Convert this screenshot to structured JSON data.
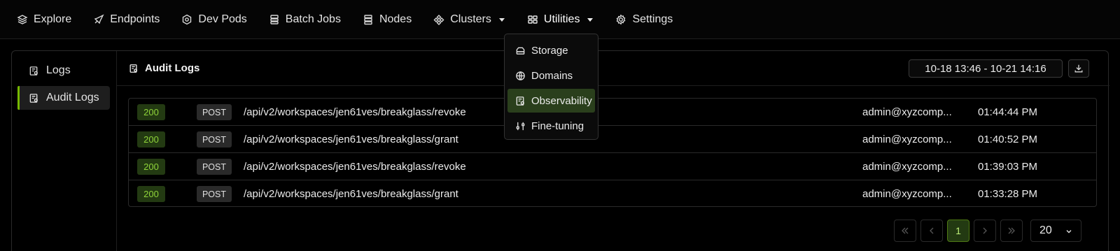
{
  "nav": {
    "items": [
      {
        "label": "Explore",
        "icon": "layers-icon"
      },
      {
        "label": "Endpoints",
        "icon": "rocket-icon"
      },
      {
        "label": "Dev Pods",
        "icon": "hexagon-icon"
      },
      {
        "label": "Batch Jobs",
        "icon": "stack-icon"
      },
      {
        "label": "Nodes",
        "icon": "server-icon"
      },
      {
        "label": "Clusters",
        "icon": "cluster-icon",
        "has_dropdown": true
      },
      {
        "label": "Utilities",
        "icon": "grid-icon",
        "has_dropdown": true,
        "open": true
      },
      {
        "label": "Settings",
        "icon": "gear-icon"
      }
    ]
  },
  "utilities_menu": {
    "items": [
      {
        "label": "Storage",
        "icon": "storage-icon"
      },
      {
        "label": "Domains",
        "icon": "globe-icon"
      },
      {
        "label": "Observability",
        "icon": "observability-icon",
        "active": true
      },
      {
        "label": "Fine-tuning",
        "icon": "sliders-icon"
      }
    ]
  },
  "sidebar": {
    "items": [
      {
        "label": "Logs",
        "icon": "logs-icon"
      },
      {
        "label": "Audit Logs",
        "icon": "audit-logs-icon",
        "active": true
      }
    ]
  },
  "content": {
    "title": "Audit Logs",
    "date_range": "10-18 13:46 - 10-21 14:16",
    "download_icon": "download-icon"
  },
  "table": {
    "rows": [
      {
        "status": "200",
        "method": "POST",
        "path": "/api/v2/workspaces/jen61ves/breakglass/revoke",
        "user": "admin@xyzcomp...",
        "time": "01:44:44 PM"
      },
      {
        "status": "200",
        "method": "POST",
        "path": "/api/v2/workspaces/jen61ves/breakglass/grant",
        "user": "admin@xyzcomp...",
        "time": "01:40:52 PM"
      },
      {
        "status": "200",
        "method": "POST",
        "path": "/api/v2/workspaces/jen61ves/breakglass/revoke",
        "user": "admin@xyzcomp...",
        "time": "01:39:03 PM"
      },
      {
        "status": "200",
        "method": "POST",
        "path": "/api/v2/workspaces/jen61ves/breakglass/grant",
        "user": "admin@xyzcomp...",
        "time": "01:33:28 PM"
      }
    ]
  },
  "pagination": {
    "current_page": "1",
    "page_size": "20"
  },
  "colors": {
    "accent": "#76b900",
    "status_bg": "#233a12",
    "status_text": "#8fd43a"
  }
}
